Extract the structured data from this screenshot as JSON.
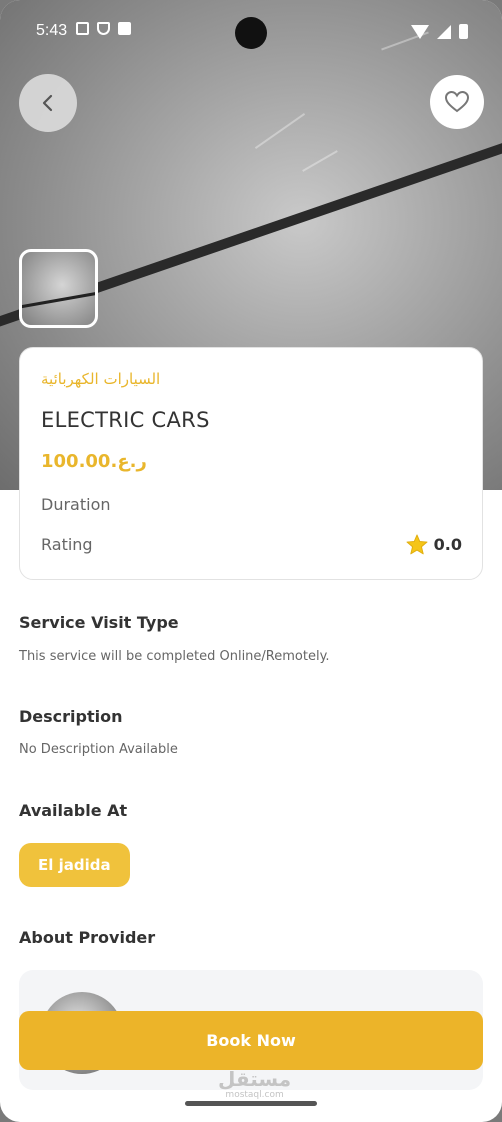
{
  "status_bar": {
    "time": "5:43"
  },
  "service": {
    "arabic_name": "السيارات الكهربائية",
    "title": "ELECTRIC CARS",
    "price": "100.00.ر.ع",
    "duration_label": "Duration",
    "rating_label": "Rating",
    "rating_value": "0.0"
  },
  "sections": {
    "visit_type_title": "Service Visit Type",
    "visit_type_text": "This service will be completed Online/Remotely.",
    "description_title": "Description",
    "description_text": "No Description Available",
    "available_title": "Available At",
    "available_location": "El jadida",
    "about_provider_title": "About Provider"
  },
  "actions": {
    "book_label": "Book Now"
  },
  "watermark": {
    "arabic": "مستقل",
    "latin": "mostaql.com"
  },
  "colors": {
    "accent": "#ecb429",
    "accent_text": "#e9b62c",
    "star": "#f5c518"
  },
  "icons": {
    "back": "chevron-left-icon",
    "favorite": "heart-icon",
    "rating": "star-icon"
  }
}
